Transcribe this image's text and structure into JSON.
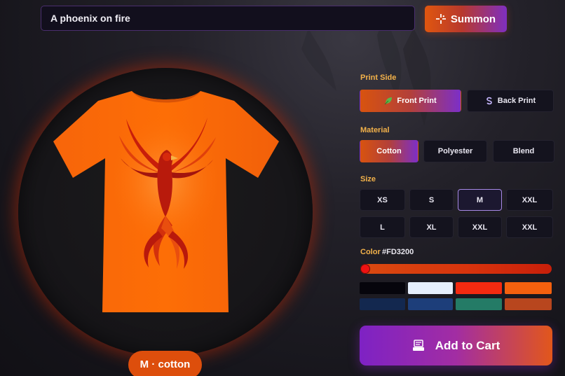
{
  "prompt": {
    "value": "A phoenix on fire"
  },
  "summon": {
    "label": "Summon",
    "icon": "sparkle-icon"
  },
  "preview": {
    "variant_label": "M · cotton",
    "shirt_color": "#FD6A00"
  },
  "print_side": {
    "label": "Print Side",
    "options": [
      {
        "label": "Front Print",
        "icon": "leaf-icon",
        "active": true
      },
      {
        "label": "Back Print",
        "icon": "swirl-icon",
        "active": false
      }
    ]
  },
  "material": {
    "label": "Material",
    "options": [
      {
        "label": "Cotton",
        "active": true
      },
      {
        "label": "Polyester",
        "active": false
      },
      {
        "label": "Blend",
        "active": false
      }
    ]
  },
  "size": {
    "label": "Size",
    "options": [
      {
        "label": "XS",
        "active": false
      },
      {
        "label": "S",
        "active": false
      },
      {
        "label": "M",
        "active": true
      },
      {
        "label": "XXL",
        "active": false
      },
      {
        "label": "L",
        "active": false
      },
      {
        "label": "XL",
        "active": false
      },
      {
        "label": "XXL",
        "active": false
      },
      {
        "label": "XXL",
        "active": false
      }
    ]
  },
  "color": {
    "label": "Color",
    "hex": "#FD3200",
    "hue_fraction": 0.0,
    "swatches": [
      "#06050c",
      "#e6effd",
      "#f42a10",
      "#f4600e",
      "#13284f",
      "#1d3e7a",
      "#247b66",
      "#b8461e"
    ]
  },
  "cart": {
    "label": "Add to Cart",
    "icon": "cart-receipt-icon"
  }
}
